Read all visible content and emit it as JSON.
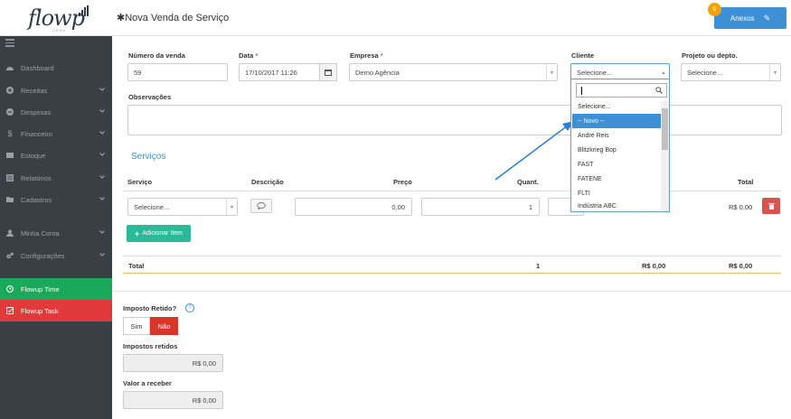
{
  "app": {
    "logo": "flowp",
    "logo_sub": "CASH"
  },
  "sidebar": {
    "items": [
      {
        "label": "Dashboard",
        "icon": "dashboard-icon"
      },
      {
        "label": "Receitas",
        "icon": "plus-circle-icon"
      },
      {
        "label": "Despesas",
        "icon": "minus-circle-icon"
      },
      {
        "label": "Financeiro",
        "icon": "dollar-icon"
      },
      {
        "label": "Estoque",
        "icon": "box-icon"
      },
      {
        "label": "Relatórios",
        "icon": "report-icon"
      },
      {
        "label": "Cadastros",
        "icon": "folder-icon"
      },
      {
        "label": "Minha Conta",
        "icon": "user-icon"
      },
      {
        "label": "Configurações",
        "icon": "gears-icon"
      }
    ],
    "flowup_time": "Flowup Time",
    "flowup_task": "Flowup Task"
  },
  "header": {
    "title": "Nova Venda de Serviço",
    "anexos_label": "Anexos",
    "anexos_count": "0"
  },
  "form": {
    "numero_label": "Número da venda",
    "numero_value": "59",
    "data_label": "Data",
    "data_value": "17/10/2017 11:26",
    "empresa_label": "Empresa",
    "empresa_value": "Demo Agência",
    "cliente_label": "Cliente",
    "cliente_value": "Selecione...",
    "projeto_label": "Projeto ou depto.",
    "projeto_value": "Selecione...",
    "obs_label": "Observações",
    "required_mark": "*"
  },
  "servicos": {
    "title": "Serviços",
    "columns": {
      "servico": "Serviço",
      "descricao": "Descrição",
      "preco": "Preço",
      "quant": "Quant.",
      "total": "Total"
    },
    "row": {
      "servico": "Selecione...",
      "preco": "0,00",
      "quant": "1",
      "total": "R$ 0,00"
    },
    "add_label": "Adicionar Item",
    "total_row": {
      "label": "Total",
      "quant": "1",
      "subtotal": "R$ 0,00",
      "total": "R$ 0,00"
    }
  },
  "impostos": {
    "retido_label": "Imposto Retido?",
    "sim": "Sim",
    "nao": "Não",
    "retidos_label": "Impostos retidos",
    "retidos_value": "R$ 0,00",
    "receber_label": "Valor a receber",
    "receber_value": "R$ 0,00"
  },
  "cliente_dropdown": {
    "options": [
      "Selecione...",
      "-- Novo --",
      "André Reis",
      "Blitzkrieg Bop",
      "FAST",
      "FATENE",
      "FLTI",
      "Indústria ABC"
    ],
    "selected_index": 1
  },
  "colors": {
    "accent": "#3d8fd6",
    "green": "#1aa85a",
    "red": "#e23a3a",
    "teal": "#2bb999",
    "badge": "#f0a30a"
  }
}
